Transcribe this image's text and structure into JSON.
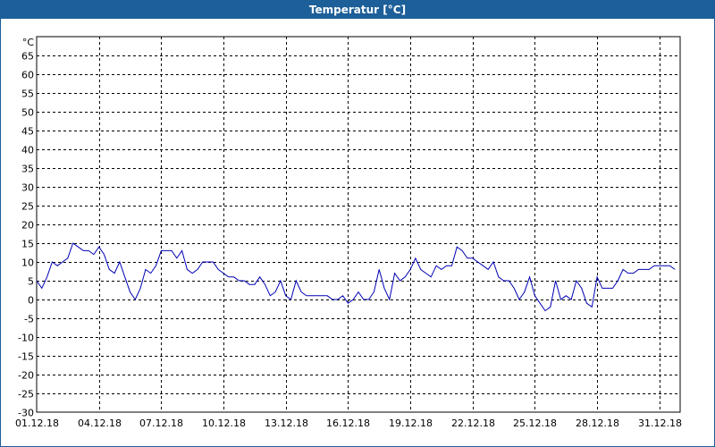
{
  "window": {
    "title": "Temperatur [°C]"
  },
  "colors": {
    "titlebar": "#1c5f99",
    "series": "#0000b4",
    "grid": "#000000"
  },
  "chart_data": {
    "type": "line",
    "title": "Temperatur [°C]",
    "unit_label": "°C",
    "xlabel": "",
    "ylabel": "",
    "ylim": [
      -30,
      70
    ],
    "yticks": [
      65,
      60,
      55,
      50,
      45,
      40,
      35,
      30,
      25,
      20,
      15,
      10,
      5,
      0,
      -5,
      -10,
      -15,
      -20,
      -25,
      -30
    ],
    "xlim": [
      "2018-12-01",
      "2019-01-01"
    ],
    "xticks": [
      "01.12.18",
      "04.12.18",
      "07.12.18",
      "10.12.18",
      "13.12.18",
      "16.12.18",
      "19.12.18",
      "22.12.18",
      "25.12.18",
      "28.12.18",
      "31.12.18"
    ],
    "grid": true,
    "grid_style": "dashed",
    "series": [
      {
        "values": [
          [
            "2018-12-01 00:00",
            5
          ],
          [
            "2018-12-01 06:00",
            3
          ],
          [
            "2018-12-01 12:00",
            6
          ],
          [
            "2018-12-01 18:00",
            10
          ],
          [
            "2018-12-02 00:00",
            9
          ],
          [
            "2018-12-02 06:00",
            10
          ],
          [
            "2018-12-02 12:00",
            11
          ],
          [
            "2018-12-02 18:00",
            15
          ],
          [
            "2018-12-03 00:00",
            14
          ],
          [
            "2018-12-03 06:00",
            13
          ],
          [
            "2018-12-03 12:00",
            13
          ],
          [
            "2018-12-03 18:00",
            12
          ],
          [
            "2018-12-04 00:00",
            14
          ],
          [
            "2018-12-04 06:00",
            12
          ],
          [
            "2018-12-04 12:00",
            8
          ],
          [
            "2018-12-04 18:00",
            7
          ],
          [
            "2018-12-05 00:00",
            10
          ],
          [
            "2018-12-05 06:00",
            6
          ],
          [
            "2018-12-05 12:00",
            2
          ],
          [
            "2018-12-05 18:00",
            0
          ],
          [
            "2018-12-06 00:00",
            3
          ],
          [
            "2018-12-06 06:00",
            8
          ],
          [
            "2018-12-06 12:00",
            7
          ],
          [
            "2018-12-06 18:00",
            9
          ],
          [
            "2018-12-07 00:00",
            13
          ],
          [
            "2018-12-07 06:00",
            13
          ],
          [
            "2018-12-07 12:00",
            13
          ],
          [
            "2018-12-07 18:00",
            11
          ],
          [
            "2018-12-08 00:00",
            13
          ],
          [
            "2018-12-08 06:00",
            8
          ],
          [
            "2018-12-08 12:00",
            7
          ],
          [
            "2018-12-08 18:00",
            8
          ],
          [
            "2018-12-09 00:00",
            10
          ],
          [
            "2018-12-09 06:00",
            10
          ],
          [
            "2018-12-09 12:00",
            10
          ],
          [
            "2018-12-09 18:00",
            8
          ],
          [
            "2018-12-10 00:00",
            7
          ],
          [
            "2018-12-10 06:00",
            6
          ],
          [
            "2018-12-10 12:00",
            6
          ],
          [
            "2018-12-10 18:00",
            5
          ],
          [
            "2018-12-11 00:00",
            5
          ],
          [
            "2018-12-11 06:00",
            4
          ],
          [
            "2018-12-11 12:00",
            4
          ],
          [
            "2018-12-11 18:00",
            6
          ],
          [
            "2018-12-12 00:00",
            4
          ],
          [
            "2018-12-12 06:00",
            1
          ],
          [
            "2018-12-12 12:00",
            2
          ],
          [
            "2018-12-12 18:00",
            5
          ],
          [
            "2018-12-13 00:00",
            1
          ],
          [
            "2018-12-13 06:00",
            0
          ],
          [
            "2018-12-13 12:00",
            5
          ],
          [
            "2018-12-13 18:00",
            2
          ],
          [
            "2018-12-14 00:00",
            1
          ],
          [
            "2018-12-14 06:00",
            1
          ],
          [
            "2018-12-14 12:00",
            1
          ],
          [
            "2018-12-14 18:00",
            1
          ],
          [
            "2018-12-15 00:00",
            1
          ],
          [
            "2018-12-15 06:00",
            0
          ],
          [
            "2018-12-15 12:00",
            0
          ],
          [
            "2018-12-15 18:00",
            1
          ],
          [
            "2018-12-16 00:00",
            -1
          ],
          [
            "2018-12-16 06:00",
            0
          ],
          [
            "2018-12-16 12:00",
            2
          ],
          [
            "2018-12-16 18:00",
            0
          ],
          [
            "2018-12-17 00:00",
            0
          ],
          [
            "2018-12-17 06:00",
            2
          ],
          [
            "2018-12-17 12:00",
            8
          ],
          [
            "2018-12-17 18:00",
            3
          ],
          [
            "2018-12-18 00:00",
            0
          ],
          [
            "2018-12-18 06:00",
            7
          ],
          [
            "2018-12-18 12:00",
            5
          ],
          [
            "2018-12-18 18:00",
            6
          ],
          [
            "2018-12-19 00:00",
            8
          ],
          [
            "2018-12-19 06:00",
            11
          ],
          [
            "2018-12-19 12:00",
            8
          ],
          [
            "2018-12-19 18:00",
            7
          ],
          [
            "2018-12-20 00:00",
            6
          ],
          [
            "2018-12-20 06:00",
            9
          ],
          [
            "2018-12-20 12:00",
            8
          ],
          [
            "2018-12-20 18:00",
            9
          ],
          [
            "2018-12-21 00:00",
            9
          ],
          [
            "2018-12-21 06:00",
            14
          ],
          [
            "2018-12-21 12:00",
            13
          ],
          [
            "2018-12-21 18:00",
            11
          ],
          [
            "2018-12-22 00:00",
            11
          ],
          [
            "2018-12-22 06:00",
            10
          ],
          [
            "2018-12-22 12:00",
            9
          ],
          [
            "2018-12-22 18:00",
            8
          ],
          [
            "2018-12-23 00:00",
            10
          ],
          [
            "2018-12-23 06:00",
            6
          ],
          [
            "2018-12-23 12:00",
            5
          ],
          [
            "2018-12-23 18:00",
            5
          ],
          [
            "2018-12-24 00:00",
            3
          ],
          [
            "2018-12-24 06:00",
            0
          ],
          [
            "2018-12-24 12:00",
            2
          ],
          [
            "2018-12-24 18:00",
            6
          ],
          [
            "2018-12-25 00:00",
            1
          ],
          [
            "2018-12-25 06:00",
            -1
          ],
          [
            "2018-12-25 12:00",
            -3
          ],
          [
            "2018-12-25 18:00",
            -2
          ],
          [
            "2018-12-26 00:00",
            5
          ],
          [
            "2018-12-26 06:00",
            0
          ],
          [
            "2018-12-26 12:00",
            1
          ],
          [
            "2018-12-26 18:00",
            0
          ],
          [
            "2018-12-27 00:00",
            5
          ],
          [
            "2018-12-27 06:00",
            3
          ],
          [
            "2018-12-27 12:00",
            -1
          ],
          [
            "2018-12-27 18:00",
            -2
          ],
          [
            "2018-12-28 00:00",
            6
          ],
          [
            "2018-12-28 06:00",
            3
          ],
          [
            "2018-12-28 12:00",
            3
          ],
          [
            "2018-12-28 18:00",
            3
          ],
          [
            "2018-12-29 00:00",
            5
          ],
          [
            "2018-12-29 06:00",
            8
          ],
          [
            "2018-12-29 12:00",
            7
          ],
          [
            "2018-12-29 18:00",
            7
          ],
          [
            "2018-12-30 00:00",
            8
          ],
          [
            "2018-12-30 06:00",
            8
          ],
          [
            "2018-12-30 12:00",
            8
          ],
          [
            "2018-12-30 18:00",
            9
          ],
          [
            "2018-12-31 00:00",
            9
          ],
          [
            "2018-12-31 06:00",
            9
          ],
          [
            "2018-12-31 12:00",
            9
          ],
          [
            "2018-12-31 18:00",
            8
          ]
        ]
      }
    ]
  }
}
